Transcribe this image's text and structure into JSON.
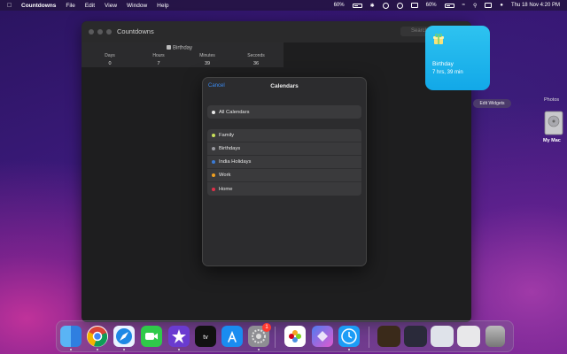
{
  "menubar": {
    "app_name": "Countdowns",
    "menus": [
      "File",
      "Edit",
      "View",
      "Window",
      "Help"
    ],
    "battery_a": "60%",
    "battery_b": "60%",
    "clock": "Thu 18 Nov  4:20 PM"
  },
  "window": {
    "title": "Countdowns",
    "search_placeholder": "Search",
    "counter": {
      "title": "Birthday",
      "units": [
        {
          "label": "Days",
          "value": "0"
        },
        {
          "label": "Hours",
          "value": "7"
        },
        {
          "label": "Minutes",
          "value": "39"
        },
        {
          "label": "Seconds",
          "value": "36"
        }
      ]
    }
  },
  "sheet": {
    "cancel_label": "Cancel",
    "title": "Calendars",
    "all_label": "All Calendars",
    "calendars": [
      {
        "label": "Family",
        "color": "#c8e05a"
      },
      {
        "label": "Birthdays",
        "color": "#9a9aa0"
      },
      {
        "label": "India Holidays",
        "color": "#3a7bd5"
      },
      {
        "label": "Work",
        "color": "#f0a020"
      },
      {
        "label": "Home",
        "color": "#e0304a"
      }
    ]
  },
  "widget": {
    "name": "Birthday",
    "time": "7 hrs, 39 min",
    "edit_label": "Edit Widgets"
  },
  "desktop": {
    "photos_label": "Photos",
    "drive_label": "My Mac"
  },
  "dock": {
    "settings_badge": "1",
    "apps": [
      "finder-icon",
      "chrome-icon",
      "safari-icon",
      "facetime-icon",
      "imovie-icon",
      "appletv-icon",
      "appstore-icon",
      "settings-icon",
      "photos-icon",
      "shortcuts-icon",
      "clock-icon"
    ]
  }
}
